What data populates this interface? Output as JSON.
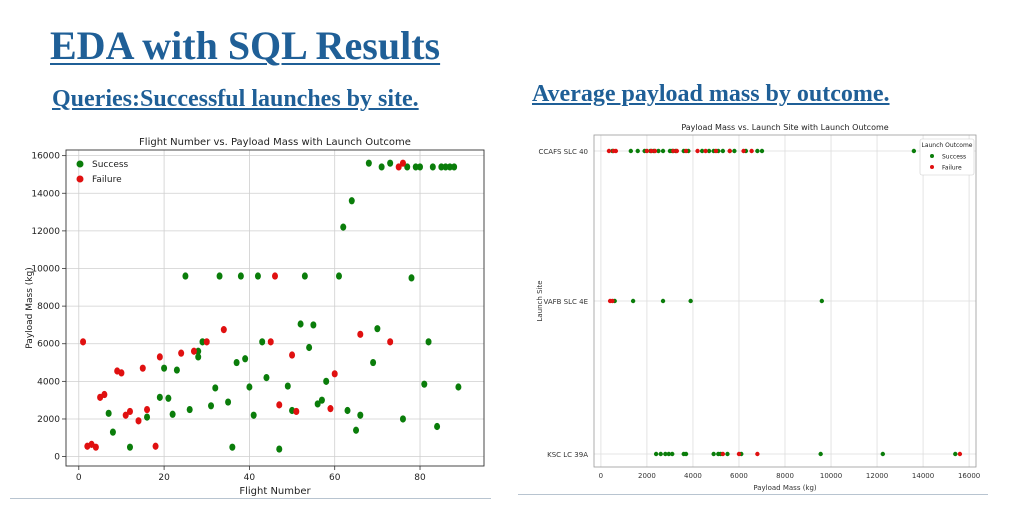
{
  "slide": {
    "title": "EDA with SQL Results",
    "section_left": "Queries:Successful launches by site.",
    "section_right": "Average payload mass by outcome."
  },
  "colors": {
    "success": "#0a7d0a",
    "failure": "#e01010",
    "heading": "#1f5f97"
  },
  "chart_data": [
    {
      "type": "scatter",
      "title": "Flight Number vs. Payload Mass with Launch Outcome",
      "xlabel": "Flight Number",
      "ylabel": "Payload Mass (kg)",
      "xlim": [
        -3,
        95
      ],
      "ylim": [
        -500,
        16300
      ],
      "xticks": [
        0,
        20,
        40,
        60,
        80
      ],
      "yticks": [
        0,
        2000,
        4000,
        6000,
        8000,
        10000,
        12000,
        14000,
        16000
      ],
      "grid": true,
      "legend_position": "top-left",
      "series": [
        {
          "name": "Success",
          "color": "#0a7d0a",
          "points": [
            [
              7,
              2300
            ],
            [
              8,
              1300
            ],
            [
              12,
              500
            ],
            [
              16,
              2100
            ],
            [
              19,
              3150
            ],
            [
              20,
              4700
            ],
            [
              21,
              3100
            ],
            [
              22,
              2250
            ],
            [
              23,
              4600
            ],
            [
              25,
              9600
            ],
            [
              26,
              2500
            ],
            [
              28,
              5300
            ],
            [
              28,
              5600
            ],
            [
              29,
              6100
            ],
            [
              31,
              2700
            ],
            [
              32,
              3650
            ],
            [
              33,
              9600
            ],
            [
              35,
              2900
            ],
            [
              36,
              500
            ],
            [
              37,
              5000
            ],
            [
              38,
              9600
            ],
            [
              39,
              5200
            ],
            [
              40,
              3700
            ],
            [
              41,
              2200
            ],
            [
              42,
              9600
            ],
            [
              43,
              6100
            ],
            [
              44,
              4200
            ],
            [
              47,
              400
            ],
            [
              49,
              3750
            ],
            [
              50,
              2450
            ],
            [
              52,
              7050
            ],
            [
              53,
              9600
            ],
            [
              54,
              5800
            ],
            [
              55,
              7000
            ],
            [
              56,
              2800
            ],
            [
              57,
              3000
            ],
            [
              58,
              4000
            ],
            [
              61,
              9600
            ],
            [
              62,
              12200
            ],
            [
              63,
              2450
            ],
            [
              64,
              13600
            ],
            [
              65,
              1400
            ],
            [
              66,
              2200
            ],
            [
              68,
              15600
            ],
            [
              69,
              5000
            ],
            [
              70,
              6800
            ],
            [
              71,
              15400
            ],
            [
              73,
              15600
            ],
            [
              76,
              2000
            ],
            [
              77,
              15400
            ],
            [
              78,
              9500
            ],
            [
              79,
              15400
            ],
            [
              80,
              15400
            ],
            [
              81,
              3850
            ],
            [
              82,
              6100
            ],
            [
              83,
              15400
            ],
            [
              84,
              1600
            ],
            [
              85,
              15400
            ],
            [
              86,
              15400
            ],
            [
              87,
              15400
            ],
            [
              88,
              15400
            ],
            [
              89,
              3700
            ]
          ]
        },
        {
          "name": "Failure",
          "color": "#e01010",
          "points": [
            [
              1,
              6100
            ],
            [
              2,
              550
            ],
            [
              3,
              650
            ],
            [
              4,
              500
            ],
            [
              5,
              3150
            ],
            [
              6,
              3300
            ],
            [
              9,
              4550
            ],
            [
              10,
              4450
            ],
            [
              11,
              2200
            ],
            [
              12,
              2400
            ],
            [
              14,
              1900
            ],
            [
              15,
              4700
            ],
            [
              16,
              2500
            ],
            [
              18,
              550
            ],
            [
              19,
              5300
            ],
            [
              24,
              5500
            ],
            [
              27,
              5600
            ],
            [
              30,
              6100
            ],
            [
              34,
              6750
            ],
            [
              45,
              6100
            ],
            [
              46,
              9600
            ],
            [
              47,
              2750
            ],
            [
              50,
              5400
            ],
            [
              51,
              2400
            ],
            [
              59,
              2550
            ],
            [
              60,
              4400
            ],
            [
              66,
              6500
            ],
            [
              73,
              6100
            ],
            [
              75,
              15400
            ],
            [
              76,
              15600
            ]
          ]
        }
      ]
    },
    {
      "type": "scatter",
      "title": "Payload Mass vs. Launch Site with Launch Outcome",
      "xlabel": "Payload Mass (kg)",
      "ylabel": "Launch Site",
      "xlim": [
        -300,
        16300
      ],
      "xticks": [
        0,
        2000,
        4000,
        6000,
        8000,
        10000,
        12000,
        14000,
        16000
      ],
      "categories": [
        "CCAFS SLC 40",
        "VAFB SLC 4E",
        "KSC LC 39A"
      ],
      "grid": true,
      "legend_title": "Launch Outcome",
      "legend_position": "top-right",
      "series": [
        {
          "name": "Success",
          "color": "#0a7d0a",
          "points": [
            [
              0,
              500
            ],
            [
              0,
              1300
            ],
            [
              0,
              1600
            ],
            [
              0,
              1900
            ],
            [
              0,
              2150
            ],
            [
              0,
              2300
            ],
            [
              0,
              2500
            ],
            [
              0,
              2700
            ],
            [
              0,
              3000
            ],
            [
              0,
              3100
            ],
            [
              0,
              3250
            ],
            [
              0,
              3600
            ],
            [
              0,
              3800
            ],
            [
              0,
              4400
            ],
            [
              0,
              4700
            ],
            [
              0,
              4900
            ],
            [
              0,
              5100
            ],
            [
              0,
              5300
            ],
            [
              0,
              5600
            ],
            [
              0,
              5800
            ],
            [
              0,
              6300
            ],
            [
              0,
              6800
            ],
            [
              0,
              7000
            ],
            [
              0,
              13600
            ],
            [
              1,
              600
            ],
            [
              1,
              1400
            ],
            [
              1,
              2700
            ],
            [
              1,
              3900
            ],
            [
              1,
              9600
            ],
            [
              2,
              2400
            ],
            [
              2,
              2600
            ],
            [
              2,
              2800
            ],
            [
              2,
              2950
            ],
            [
              2,
              3100
            ],
            [
              2,
              3600
            ],
            [
              2,
              3700
            ],
            [
              2,
              4900
            ],
            [
              2,
              5100
            ],
            [
              2,
              5200
            ],
            [
              2,
              5500
            ],
            [
              2,
              6100
            ],
            [
              2,
              9550
            ],
            [
              2,
              12250
            ],
            [
              2,
              15400
            ]
          ]
        },
        {
          "name": "Failure",
          "color": "#e01010",
          "points": [
            [
              0,
              350
            ],
            [
              0,
              550
            ],
            [
              0,
              650
            ],
            [
              0,
              2000
            ],
            [
              0,
              2200
            ],
            [
              0,
              2350
            ],
            [
              0,
              3150
            ],
            [
              0,
              3300
            ],
            [
              0,
              3700
            ],
            [
              0,
              4200
            ],
            [
              0,
              4550
            ],
            [
              0,
              5000
            ],
            [
              0,
              5600
            ],
            [
              0,
              6200
            ],
            [
              0,
              6550
            ],
            [
              1,
              400
            ],
            [
              1,
              500
            ],
            [
              2,
              5300
            ],
            [
              2,
              6000
            ],
            [
              2,
              6800
            ],
            [
              2,
              15600
            ]
          ]
        }
      ]
    }
  ]
}
